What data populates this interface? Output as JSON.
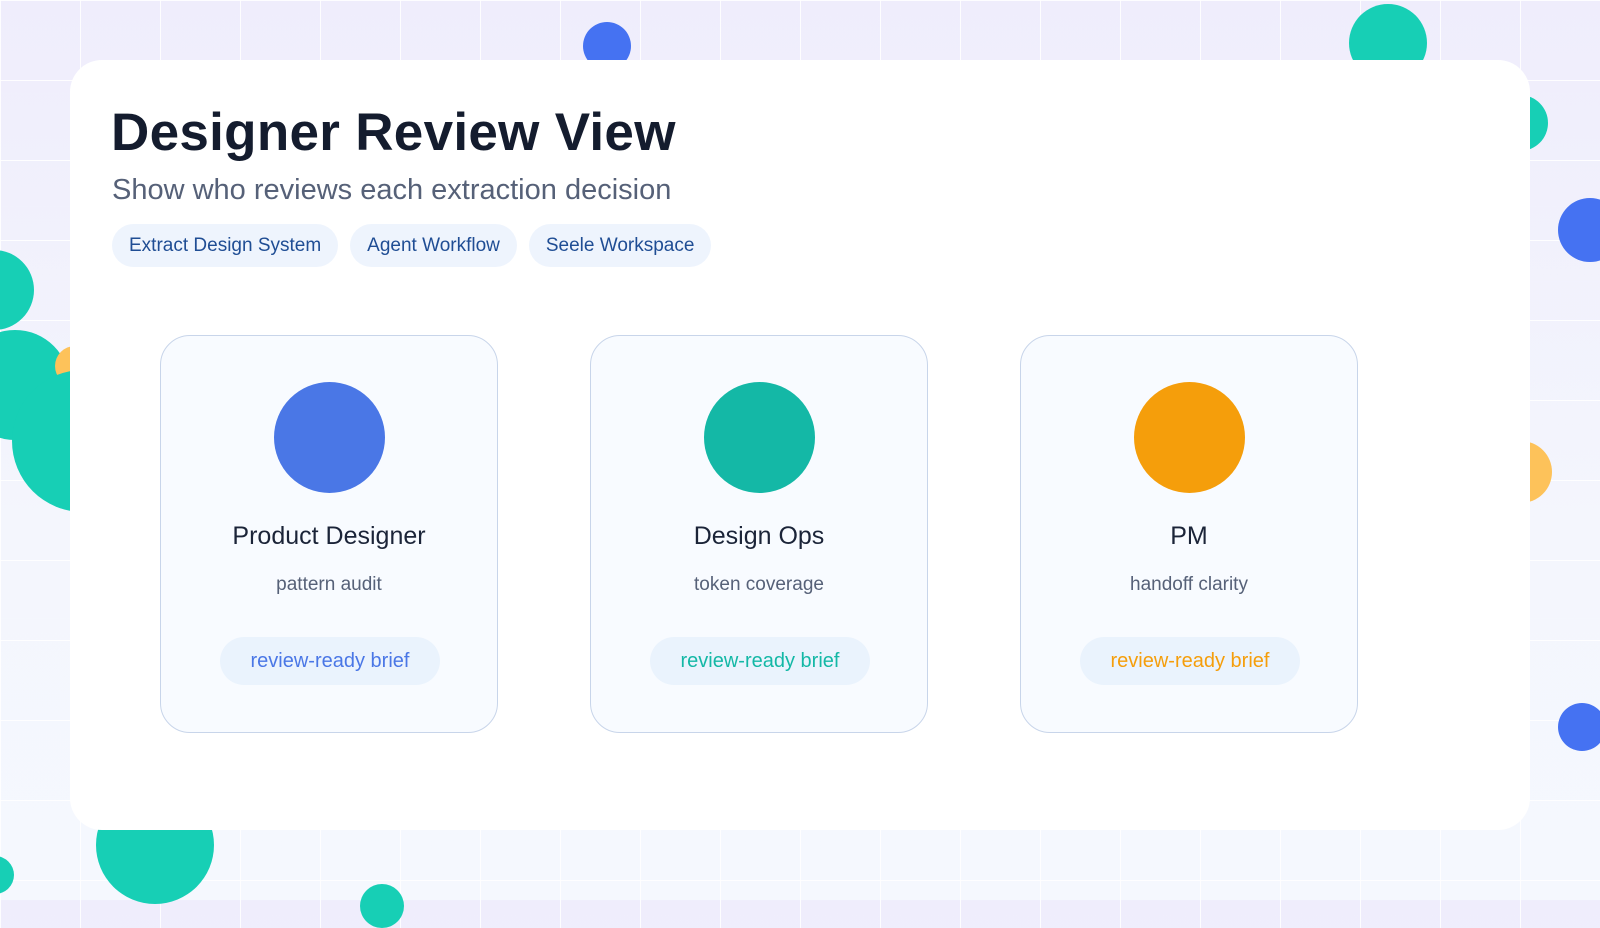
{
  "header": {
    "title": "Designer Review View",
    "subtitle": "Show who reviews each extraction decision",
    "tags": [
      {
        "label": "Extract Design System"
      },
      {
        "label": "Agent Workflow"
      },
      {
        "label": "Seele Workspace"
      }
    ]
  },
  "reviewers": [
    {
      "role": "Product Designer",
      "focus": "pattern audit",
      "status": "review-ready brief",
      "color": "#4a77e6"
    },
    {
      "role": "Design Ops",
      "focus": "token coverage",
      "status": "review-ready brief",
      "color": "#14b8a6"
    },
    {
      "role": "PM",
      "focus": "handoff clarity",
      "status": "review-ready brief",
      "color": "#f59e0b"
    }
  ],
  "colors": {
    "accent_blue": "#4572f2",
    "accent_teal": "#17cfb5",
    "accent_amber": "#fdc25a",
    "title_text": "#141c2e",
    "tag_text": "#1f4d94"
  }
}
